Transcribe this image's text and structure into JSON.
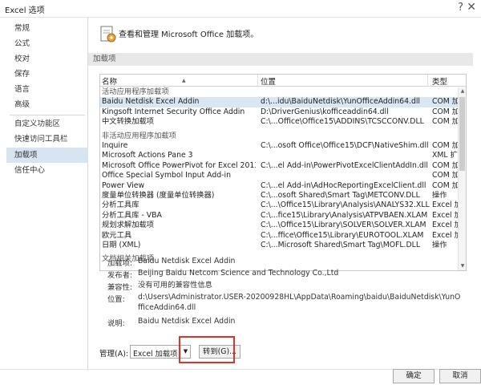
{
  "window": {
    "title": "Excel 选项",
    "help_glyph": "?",
    "close_glyph": "✕"
  },
  "sidebar": {
    "items": [
      {
        "label": "常规"
      },
      {
        "label": "公式"
      },
      {
        "label": "校对"
      },
      {
        "label": "保存"
      },
      {
        "label": "语言"
      },
      {
        "label": "高级"
      },
      {
        "label": "自定义功能区"
      },
      {
        "label": "快速访问工具栏"
      },
      {
        "label": "加载项",
        "selected": true
      },
      {
        "label": "信任中心"
      }
    ]
  },
  "main": {
    "hero_text": "查看和管理 Microsoft Office 加载项。",
    "group_header": "加载项"
  },
  "list": {
    "columns": {
      "name": "名称",
      "sort_glyph": "▲",
      "location": "位置",
      "type": "类型"
    },
    "sections": [
      {
        "label": "活动应用程序加载项",
        "rows": [
          {
            "name": "Baidu Netdisk Excel Addin",
            "location": "d:\\...idu\\BaiduNetdisk\\YunOfficeAddin64.dll",
            "type": "COM 加载项",
            "selected": true
          },
          {
            "name": "Kingsoft Internet Security Office Addin",
            "location": "D:\\DriverGenius\\kofficeaddin64.dll",
            "type": "COM 加载项"
          },
          {
            "name": "中文转换加载项",
            "location": "C:\\...Office\\Office15\\ADDINS\\TCSCCONV.DLL",
            "type": "COM 加载项"
          }
        ]
      },
      {
        "label": "非活动应用程序加载项",
        "rows": [
          {
            "name": "Inquire",
            "location": "C:\\...osoft Office\\Office15\\DCF\\NativeShim.dll",
            "type": "COM 加载项"
          },
          {
            "name": "Microsoft Actions Pane 3",
            "location": "",
            "type": "XML 扩展包"
          },
          {
            "name": "Microsoft Office PowerPivot for Excel 2013",
            "location": "C:\\...el Add-in\\PowerPivotExcelClientAddIn.dll",
            "type": "COM 加载项"
          },
          {
            "name": "Office Special Symbol Input Add-in",
            "location": "",
            "type": "COM 加载项"
          },
          {
            "name": "Power View",
            "location": "C:\\...el Add-in\\AdHocReportingExcelClient.dll",
            "type": "COM 加载项"
          },
          {
            "name": "度量单位转换器 (度量单位转换器)",
            "location": "C:\\...osoft Shared\\Smart Tag\\METCONV.DLL",
            "type": "操作"
          },
          {
            "name": "分析工具库",
            "location": "C:\\...\\Office15\\Library\\Analysis\\ANALYS32.XLL",
            "type": "Excel 加载项"
          },
          {
            "name": "分析工具库 - VBA",
            "location": "C:\\...fice15\\Library\\Analysis\\ATPVBAEN.XLAM",
            "type": "Excel 加载项"
          },
          {
            "name": "规划求解加载项",
            "location": "C:\\...\\Office15\\Library\\SOLVER\\SOLVER.XLAM",
            "type": "Excel 加载项"
          },
          {
            "name": "欧元工具",
            "location": "C:\\...ffice\\Office15\\Library\\EUROTOOL.XLAM",
            "type": "Excel 加载项"
          },
          {
            "name": "日期 (XML)",
            "location": "C:\\...Microsoft Shared\\Smart Tag\\MOFL.DLL",
            "type": "操作"
          }
        ]
      },
      {
        "label": "文档相关加载项",
        "rows": []
      }
    ],
    "scroll": {
      "up_glyph": "▲",
      "down_glyph": "▼"
    }
  },
  "details": {
    "addin_label": "加载项:",
    "addin_value": "Baidu Netdisk Excel Addin",
    "publisher_label": "发布者:",
    "publisher_value": "Beijing Baidu Netcom Science and Technology Co.,Ltd",
    "compat_label": "兼容性:",
    "compat_value": "没有可用的兼容性信息",
    "location_label": "位置:",
    "location_value": "d:\\Users\\Administrator.USER-20200928HL\\AppData\\Roaming\\baidu\\BaiduNetdisk\\YunOfficeAddin64.dll",
    "desc_label": "说明:",
    "desc_value": "Baidu Netdisk Excel Addin"
  },
  "manage": {
    "label": "管理(A):",
    "select_value": "Excel 加载项",
    "dropdown_glyph": "▼",
    "goto_label": "转到(G)..."
  },
  "buttons": {
    "ok": "确定",
    "cancel": "取消"
  },
  "colors": {
    "selection": "#d7e4f2",
    "highlight_box": "#e0312b"
  }
}
